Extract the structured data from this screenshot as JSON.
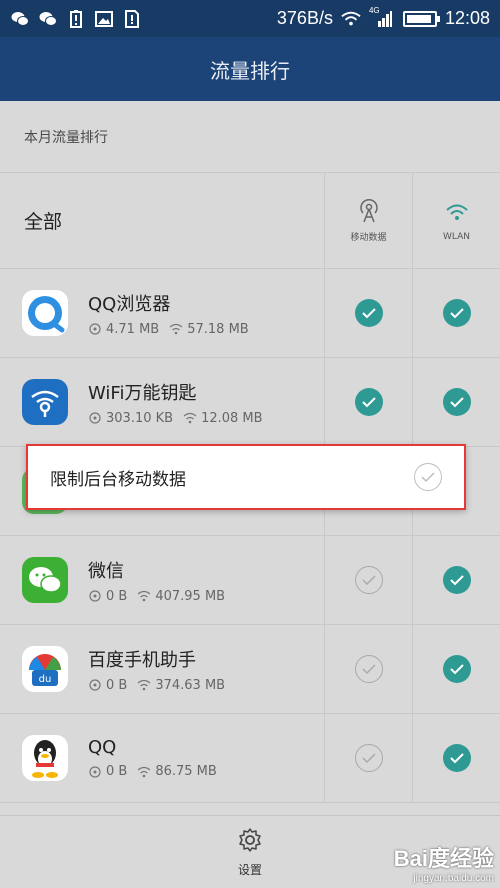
{
  "status_bar": {
    "net_speed": "376B/s",
    "network_type": "4G",
    "time": "12:08",
    "icons": [
      "wechat-icon",
      "wechat-icon",
      "battery-alert-icon",
      "photo-icon",
      "sim-icon",
      "wifi-icon",
      "signal-icon",
      "battery-icon"
    ]
  },
  "title": "流量排行",
  "subtitle": "本月流量排行",
  "header": {
    "all_label": "全部",
    "col_mobile": "移动数据",
    "col_wlan": "WLAN"
  },
  "apps": [
    {
      "name": "QQ浏览器",
      "mobile": "4.71 MB",
      "wifi": "57.18 MB",
      "mobile_on": true,
      "wlan_on": true,
      "icon": "qq-browser-icon"
    },
    {
      "name": "WiFi万能钥匙",
      "mobile": "303.10 KB",
      "wifi": "12.08 MB",
      "mobile_on": true,
      "wlan_on": true,
      "icon": "wifi-key-icon"
    },
    {
      "name": "",
      "mobile": "",
      "wifi": "",
      "mobile_on": true,
      "wlan_on": true,
      "icon": "green-app-icon"
    },
    {
      "name": "微信",
      "mobile": "0 B",
      "wifi": "407.95 MB",
      "mobile_on": false,
      "wlan_on": true,
      "icon": "wechat-icon"
    },
    {
      "name": "百度手机助手",
      "mobile": "0 B",
      "wifi": "374.63 MB",
      "mobile_on": false,
      "wlan_on": true,
      "icon": "baidu-assistant-icon"
    },
    {
      "name": "QQ",
      "mobile": "0 B",
      "wifi": "86.75 MB",
      "mobile_on": false,
      "wlan_on": true,
      "icon": "qq-penguin-icon"
    }
  ],
  "dialog": {
    "label": "限制后台移动数据",
    "checked": false
  },
  "bottom": {
    "settings_label": "设置"
  },
  "watermark": {
    "logo": "Bai度经验",
    "url": "jingyan.baidu.com"
  },
  "colors": {
    "status_bar": "#183b66",
    "title_bar": "#1d4478",
    "check_on": "#2f9a94",
    "highlight_border": "#e53935"
  }
}
